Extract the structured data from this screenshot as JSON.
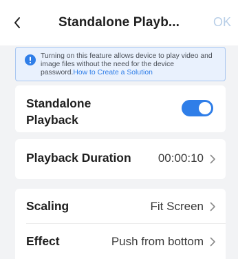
{
  "header": {
    "title": "Standalone Playb...",
    "ok_label": "OK"
  },
  "notice": {
    "text": "Turning on this feature allows device to play video and image files without the need for the device password.",
    "link": "How to Create a Solution"
  },
  "standalone": {
    "label": "Standalone Playback",
    "enabled": true
  },
  "duration": {
    "label": "Playback Duration",
    "value": "00:00:10"
  },
  "scaling": {
    "label": "Scaling",
    "value": "Fit Screen"
  },
  "effect": {
    "label": "Effect",
    "value": "Push from bottom"
  },
  "colors": {
    "accent": "#2f7ee8",
    "ok_disabled": "#b9cfe8",
    "notice_bg": "#e9f1fd",
    "page_bg": "#f2f3f5"
  },
  "icons": [
    "back-chevron-icon",
    "info-icon",
    "chevron-right-icon"
  ]
}
